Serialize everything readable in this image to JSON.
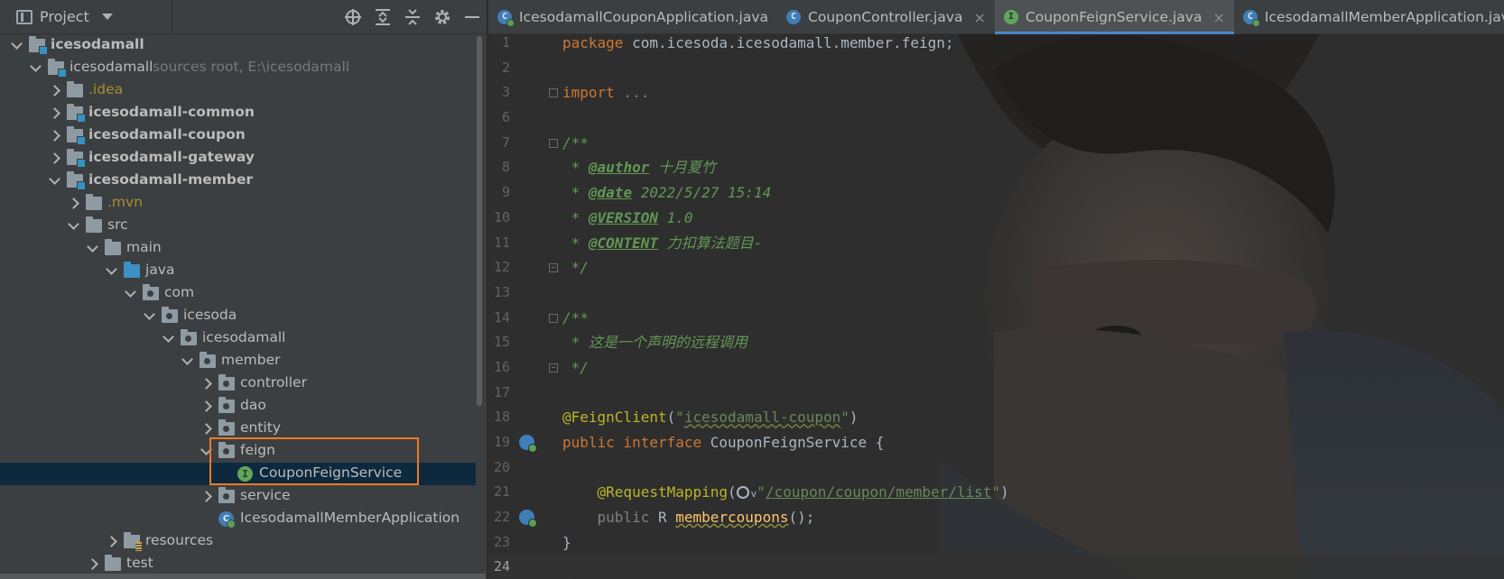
{
  "project_panel": {
    "title": "Project",
    "tools": [
      "locate-icon",
      "expand-all-icon",
      "collapse-all-icon",
      "settings-icon",
      "minimize-icon"
    ],
    "tree": [
      {
        "depth": 0,
        "expand": "down",
        "icon": "module-folder",
        "label": "icesodamall",
        "style": "bold"
      },
      {
        "depth": 1,
        "expand": "down",
        "icon": "module-folder",
        "label": "icesodamall",
        "hint": "sources root,  E:\\icesodamall"
      },
      {
        "depth": 2,
        "expand": "right",
        "icon": "folder",
        "label": ".idea",
        "style": "yellow"
      },
      {
        "depth": 2,
        "expand": "right",
        "icon": "module-folder",
        "label": "icesodamall-common",
        "style": "bold"
      },
      {
        "depth": 2,
        "expand": "right",
        "icon": "module-folder",
        "label": "icesodamall-coupon",
        "style": "bold"
      },
      {
        "depth": 2,
        "expand": "right",
        "icon": "module-folder",
        "label": "icesodamall-gateway",
        "style": "bold"
      },
      {
        "depth": 2,
        "expand": "down",
        "icon": "module-folder",
        "label": "icesodamall-member",
        "style": "bold"
      },
      {
        "depth": 3,
        "expand": "right",
        "icon": "folder",
        "label": ".mvn",
        "style": "yellow"
      },
      {
        "depth": 3,
        "expand": "down",
        "icon": "folder",
        "label": "src"
      },
      {
        "depth": 4,
        "expand": "down",
        "icon": "folder",
        "label": "main"
      },
      {
        "depth": 5,
        "expand": "down",
        "icon": "source-folder",
        "label": "java"
      },
      {
        "depth": 6,
        "expand": "down",
        "icon": "package",
        "label": "com"
      },
      {
        "depth": 7,
        "expand": "down",
        "icon": "package",
        "label": "icesoda"
      },
      {
        "depth": 8,
        "expand": "down",
        "icon": "package",
        "label": "icesodamall"
      },
      {
        "depth": 9,
        "expand": "down",
        "icon": "package",
        "label": "member"
      },
      {
        "depth": 10,
        "expand": "right",
        "icon": "package",
        "label": "controller"
      },
      {
        "depth": 10,
        "expand": "right",
        "icon": "package",
        "label": "dao"
      },
      {
        "depth": 10,
        "expand": "right",
        "icon": "package",
        "label": "entity"
      },
      {
        "depth": 10,
        "expand": "down",
        "icon": "package",
        "label": "feign"
      },
      {
        "depth": 11,
        "expand": "none",
        "icon": "interface",
        "label": "CouponFeignService",
        "selected": true
      },
      {
        "depth": 10,
        "expand": "right",
        "icon": "package",
        "label": "service"
      },
      {
        "depth": 10,
        "expand": "none",
        "icon": "spring-class",
        "label": "IcesodamallMemberApplication"
      },
      {
        "depth": 5,
        "expand": "right",
        "icon": "resources-folder",
        "label": "resources"
      },
      {
        "depth": 4,
        "expand": "right",
        "icon": "folder",
        "label": "test"
      }
    ]
  },
  "tabs": [
    {
      "label": "IcesodamallCouponApplication.java",
      "icon": "spring",
      "glyph": "C",
      "closable": false,
      "active": false
    },
    {
      "label": "CouponController.java",
      "icon": "cls",
      "glyph": "C",
      "closable": true,
      "active": false
    },
    {
      "label": "CouponFeignService.java",
      "icon": "iface",
      "glyph": "I",
      "closable": true,
      "active": true
    },
    {
      "label": "IcesodamallMemberApplication.java",
      "icon": "spring",
      "glyph": "C",
      "closable": false,
      "active": false
    }
  ],
  "colors": {
    "accent": "#4a88c7",
    "highlight_box": "#ee7a21",
    "keyword": "#cc7832",
    "annotation": "#bbb529",
    "comment": "#629755",
    "string": "#6a8759"
  },
  "code": {
    "l1_kw": "package",
    "l1_rest": " com.icesoda.icesodamall.member.feign;",
    "l3_kw": "import",
    "l3_rest": " ...",
    "l7": "/**",
    "l8_pre": " * ",
    "l8_tag": "@author",
    "l8_val": " 十月夏竹",
    "l9_pre": " * ",
    "l9_tag": "@date",
    "l9_val": " 2022/5/27 15:14",
    "l10_pre": " * ",
    "l10_tag": "@VERSION",
    "l10_val": " 1.0",
    "l11_pre": " * ",
    "l11_tag": "@CONTENT",
    "l11_val": " 力扣算法题目-",
    "l12": " */",
    "l14": "/**",
    "l15": " * 这是一个声明的远程调用",
    "l16": " */",
    "l18_ann": "@FeignClient",
    "l18_open": "(",
    "l18_q1": "\"",
    "l18_str": "icesodamall-coupon",
    "l18_q2": "\"",
    "l18_close": ")",
    "l19_kw": "public interface",
    "l19_rest": " CouponFeignService {",
    "l21_indent": "    ",
    "l21_ann": "@RequestMapping",
    "l21_open": "(",
    "l21_chev": "v",
    "l21_q1": "\"",
    "l21_str": "/coupon/coupon/member/list",
    "l21_q2": "\"",
    "l21_close": ")",
    "l22_indent": "    ",
    "l22_kw": "public",
    "l22_type": " R ",
    "l22_meth": "membercoupons",
    "l22_rest": "();",
    "l23": "}"
  }
}
